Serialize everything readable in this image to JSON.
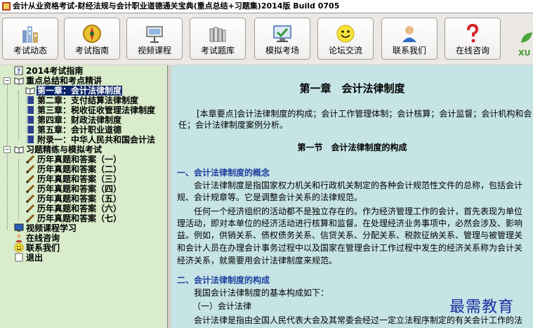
{
  "window": {
    "title": "会计从业资格考试-财经法规与会计职业道德通关宝典(重点总结+习题集)2014版 Build 0705"
  },
  "toolbar": {
    "buttons": [
      {
        "label": "考试动态",
        "icon": "city-buildings-icon"
      },
      {
        "label": "考试指南",
        "icon": "compass-badge-icon"
      },
      {
        "label": "视频课程",
        "icon": "projector-icon"
      },
      {
        "label": "考试题库",
        "icon": "books-icon"
      },
      {
        "label": "模拟考场",
        "icon": "monitor-check-icon"
      },
      {
        "label": "论坛交流",
        "icon": "smiley-icon"
      },
      {
        "label": "联系我们",
        "icon": "contact-person-icon"
      },
      {
        "label": "在线咨询",
        "icon": "question-mark-icon"
      }
    ],
    "brand_text": "XU"
  },
  "tree": {
    "items": [
      {
        "label": "2014考试指南"
      },
      {
        "label": "重点总结和考点精讲"
      },
      {
        "label": "第一章：会计法律制度"
      },
      {
        "label": "第二章：支付结算法律制度"
      },
      {
        "label": "第三章：税收征收管理法律制度"
      },
      {
        "label": "第四章：财政法律制度"
      },
      {
        "label": "第五章：会计职业道德"
      },
      {
        "label": "附录一：中华人民共和国会计法"
      },
      {
        "label": "习题精练与模拟考试"
      },
      {
        "label": "历年真题和答案（一）"
      },
      {
        "label": "历年真题和答案（二）"
      },
      {
        "label": "历年真题和答案（三）"
      },
      {
        "label": "历年真题和答案（四）"
      },
      {
        "label": "历年真题和答案（五）"
      },
      {
        "label": "历年真题和答案（六）"
      },
      {
        "label": "历年真题和答案（七）"
      },
      {
        "label": "视频课程学习"
      },
      {
        "label": "在线咨询"
      },
      {
        "label": "联系我们"
      },
      {
        "label": "退出"
      }
    ],
    "selected": "第一章：会计法律制度"
  },
  "content": {
    "chapter_title": "第一章　会计法律制度",
    "key_points_label": "[本章要点]",
    "key_points_text": "会计法律制度的构成；会计工作管理体制；会计核算；会计监督；会计机构和会",
    "key_points_text_2": "任；会计法律制度案例分析。",
    "section_title": "第一节　会计法律制度的构成",
    "h1": "一、会计法律制度的概念",
    "p1_l1": "会计法律制度是指国家权力机关和行政机关制定的各种会计规范性文件的总称，包括会计",
    "p1_l2": "规、会计规章等。它是调整会计关系的法律规范。",
    "p2_l1": "任何一个经济组织的活动都不是独立存在的。作为经济管理工作的会计，首先表现为单位",
    "p2_l2": "理活动，即对本单位的经济活动进行核算和监督。在处理经济业务事项中，必然会涉及、影响",
    "p2_l3": "益。例如，供销关系、债权债务关系、信贷关系、分配关系、税款征纳关系、管理与被管理关",
    "p2_l4": "和会计人员在办理会计事务过程中以及国家在管理会计工作过程中发生的经济关系称为会计关",
    "p2_l5": "经济关系，就需要用会计法律制度来规范。",
    "h2": "二、会计法律制度的构成",
    "p3": "我国会计法律制度的基本构成如下：",
    "p4": "（一）会计法律",
    "p5": "会计法律是指由全国人民代表大会及其常委会经过一定立法程序制定的有关会计工作的法"
  },
  "watermark": "最需教育",
  "colors": {
    "tree_bg": "#d9eccb",
    "content_bg": "#c6e4e6",
    "heading_blue": "#1f3f9f",
    "selection": "#0a246a"
  }
}
